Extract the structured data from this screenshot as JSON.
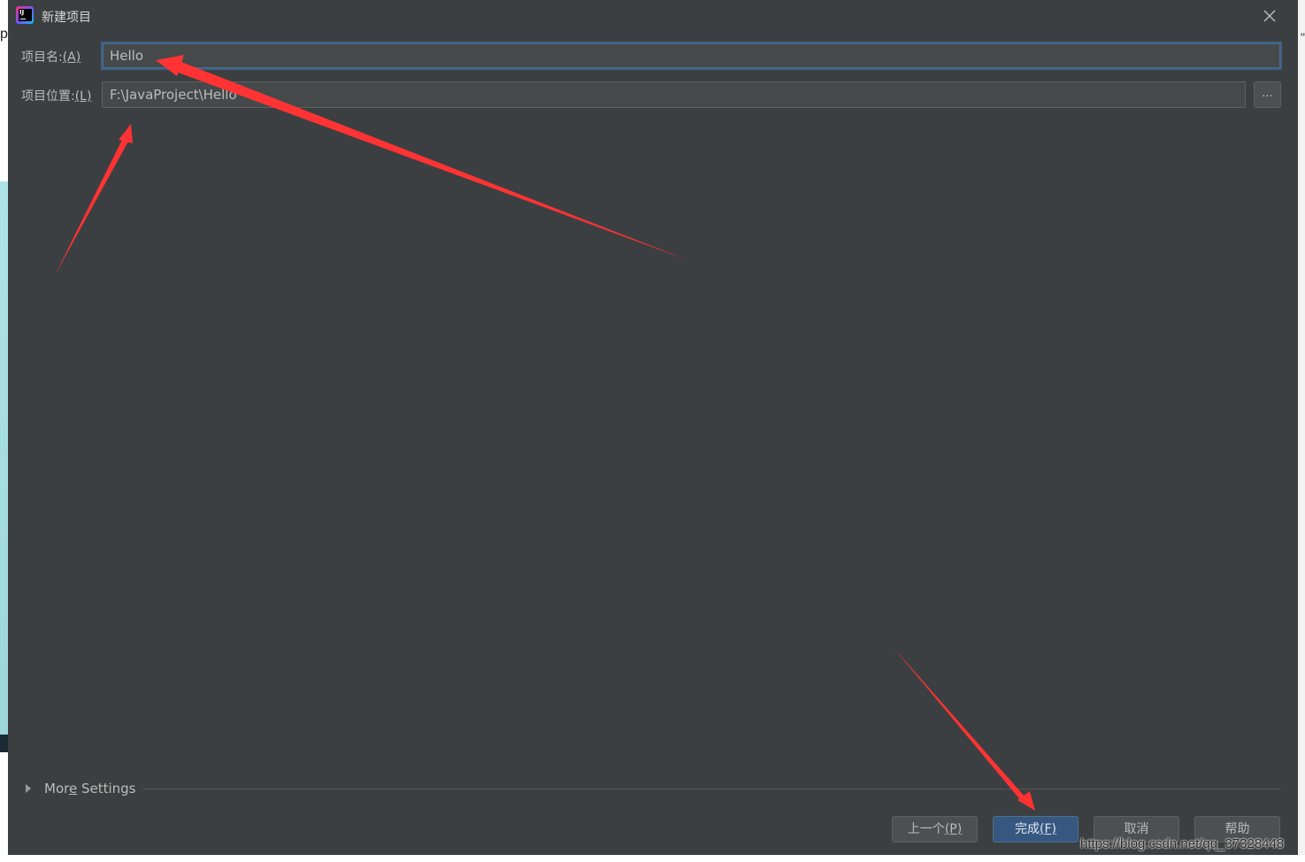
{
  "background": {
    "left_text": "pi",
    "right_text": "\""
  },
  "dialog": {
    "title": "新建项目",
    "project_name": {
      "label": "项目名:",
      "mnemonic": "(A)",
      "value": "Hello"
    },
    "project_location": {
      "label": "项目位置:",
      "mnemonic": "(L)",
      "value": "F:\\JavaProject\\Hello",
      "browse_label": "..."
    },
    "more_settings": {
      "prefix": "Mor",
      "mnemonic": "e",
      "suffix": " Settings"
    },
    "buttons": {
      "previous": {
        "label": "上一个",
        "mnemonic": "(P)"
      },
      "finish": {
        "label": "完成",
        "mnemonic": "(F)"
      },
      "cancel": {
        "label": "取消"
      },
      "help": {
        "label": "帮助"
      }
    }
  },
  "watermark": "https://blog.csdn.net/qq_37328448",
  "colors": {
    "dialog_bg": "#3c3f41",
    "accent": "#365880",
    "annotation_arrow": "#ff3333"
  },
  "icons": {
    "app": "intellij-idea-icon",
    "close": "close-icon",
    "expand": "triangle-right-icon"
  }
}
